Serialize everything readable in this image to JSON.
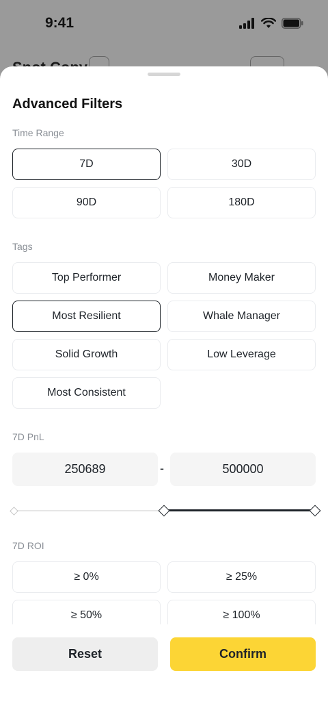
{
  "status": {
    "time": "9:41"
  },
  "background": {
    "title": "Spot Copy"
  },
  "sheet": {
    "title": "Advanced Filters",
    "time_range": {
      "label": "Time Range",
      "options": [
        "7D",
        "30D",
        "90D",
        "180D"
      ],
      "selected": "7D"
    },
    "tags": {
      "label": "Tags",
      "options": [
        "Top Performer",
        "Money Maker",
        "Most Resilient",
        "Whale Manager",
        "Solid Growth",
        "Low Leverage",
        "Most Consistent"
      ],
      "selected": "Most Resilient"
    },
    "pnl": {
      "label": "7D PnL",
      "min_value": "250689",
      "max_value": "500000",
      "separator": "-",
      "slider_low_fraction": 0.5,
      "slider_high_fraction": 1.0
    },
    "roi": {
      "label": "7D ROI",
      "options": [
        "≥ 0%",
        "≥ 25%",
        "≥ 50%",
        "≥ 100%"
      ]
    },
    "footer": {
      "reset_label": "Reset",
      "confirm_label": "Confirm"
    }
  },
  "colors": {
    "accent": "#fcd535",
    "text": "#1e2329",
    "muted": "#8a8f96",
    "border": "#eaecef"
  }
}
